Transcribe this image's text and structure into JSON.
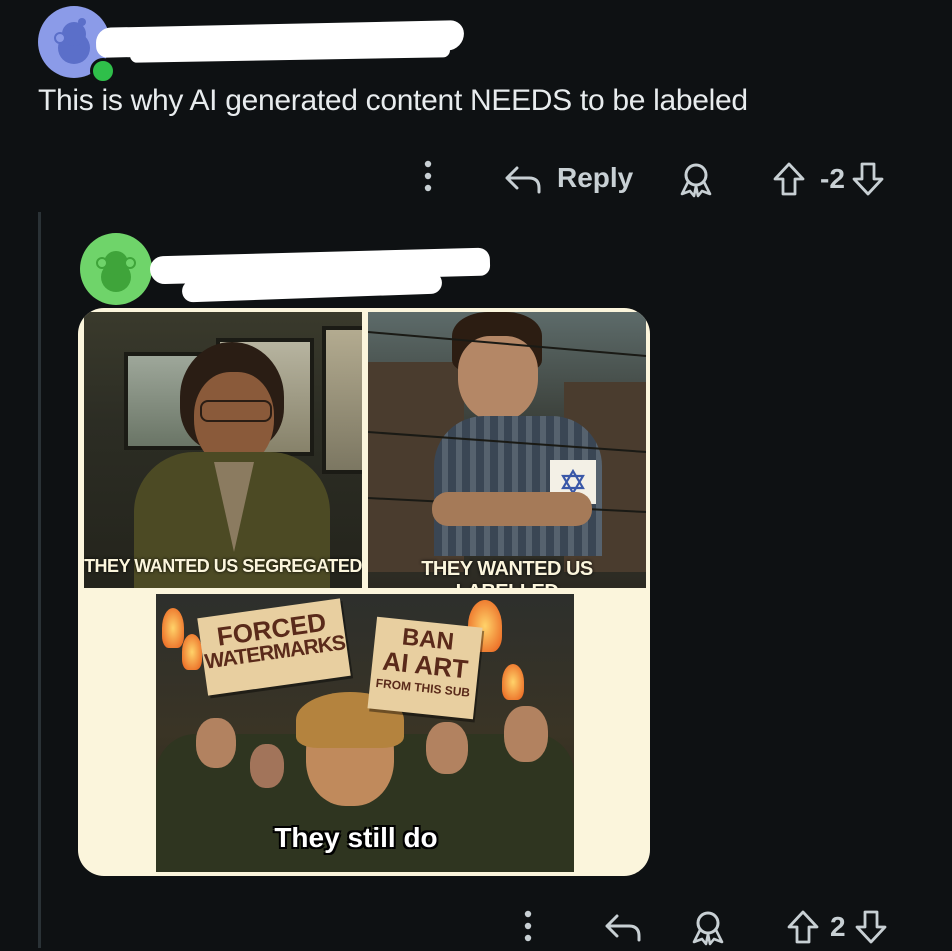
{
  "parent_comment": {
    "username": "",
    "text": "This is why AI generated content NEEDS to be labeled",
    "actions": {
      "reply_label": "Reply",
      "score": "-2"
    }
  },
  "child_comment": {
    "username": "",
    "score": "2",
    "meme": {
      "panel1_caption": "THEY WANTED US SEGREGATED",
      "panel2_caption": "THEY WANTED US LABELLED",
      "sign1_line1": "FORCED",
      "sign1_line2": "WATERMARKS",
      "sign2_line1": "BAN",
      "sign2_line2": "AI ART",
      "sign2_line3": "FROM THIS SUB",
      "panel3_caption": "They still do"
    }
  },
  "colors": {
    "background": "#0e1113",
    "avatar_parent": "#8b9be8",
    "avatar_child": "#6fd46a",
    "online_dot": "#2fbf4a",
    "meme_border": "#fbf5dc"
  },
  "icons": [
    "overflow-icon",
    "reply-icon",
    "award-icon",
    "upvote-icon",
    "downvote-icon",
    "snoo-icon"
  ]
}
